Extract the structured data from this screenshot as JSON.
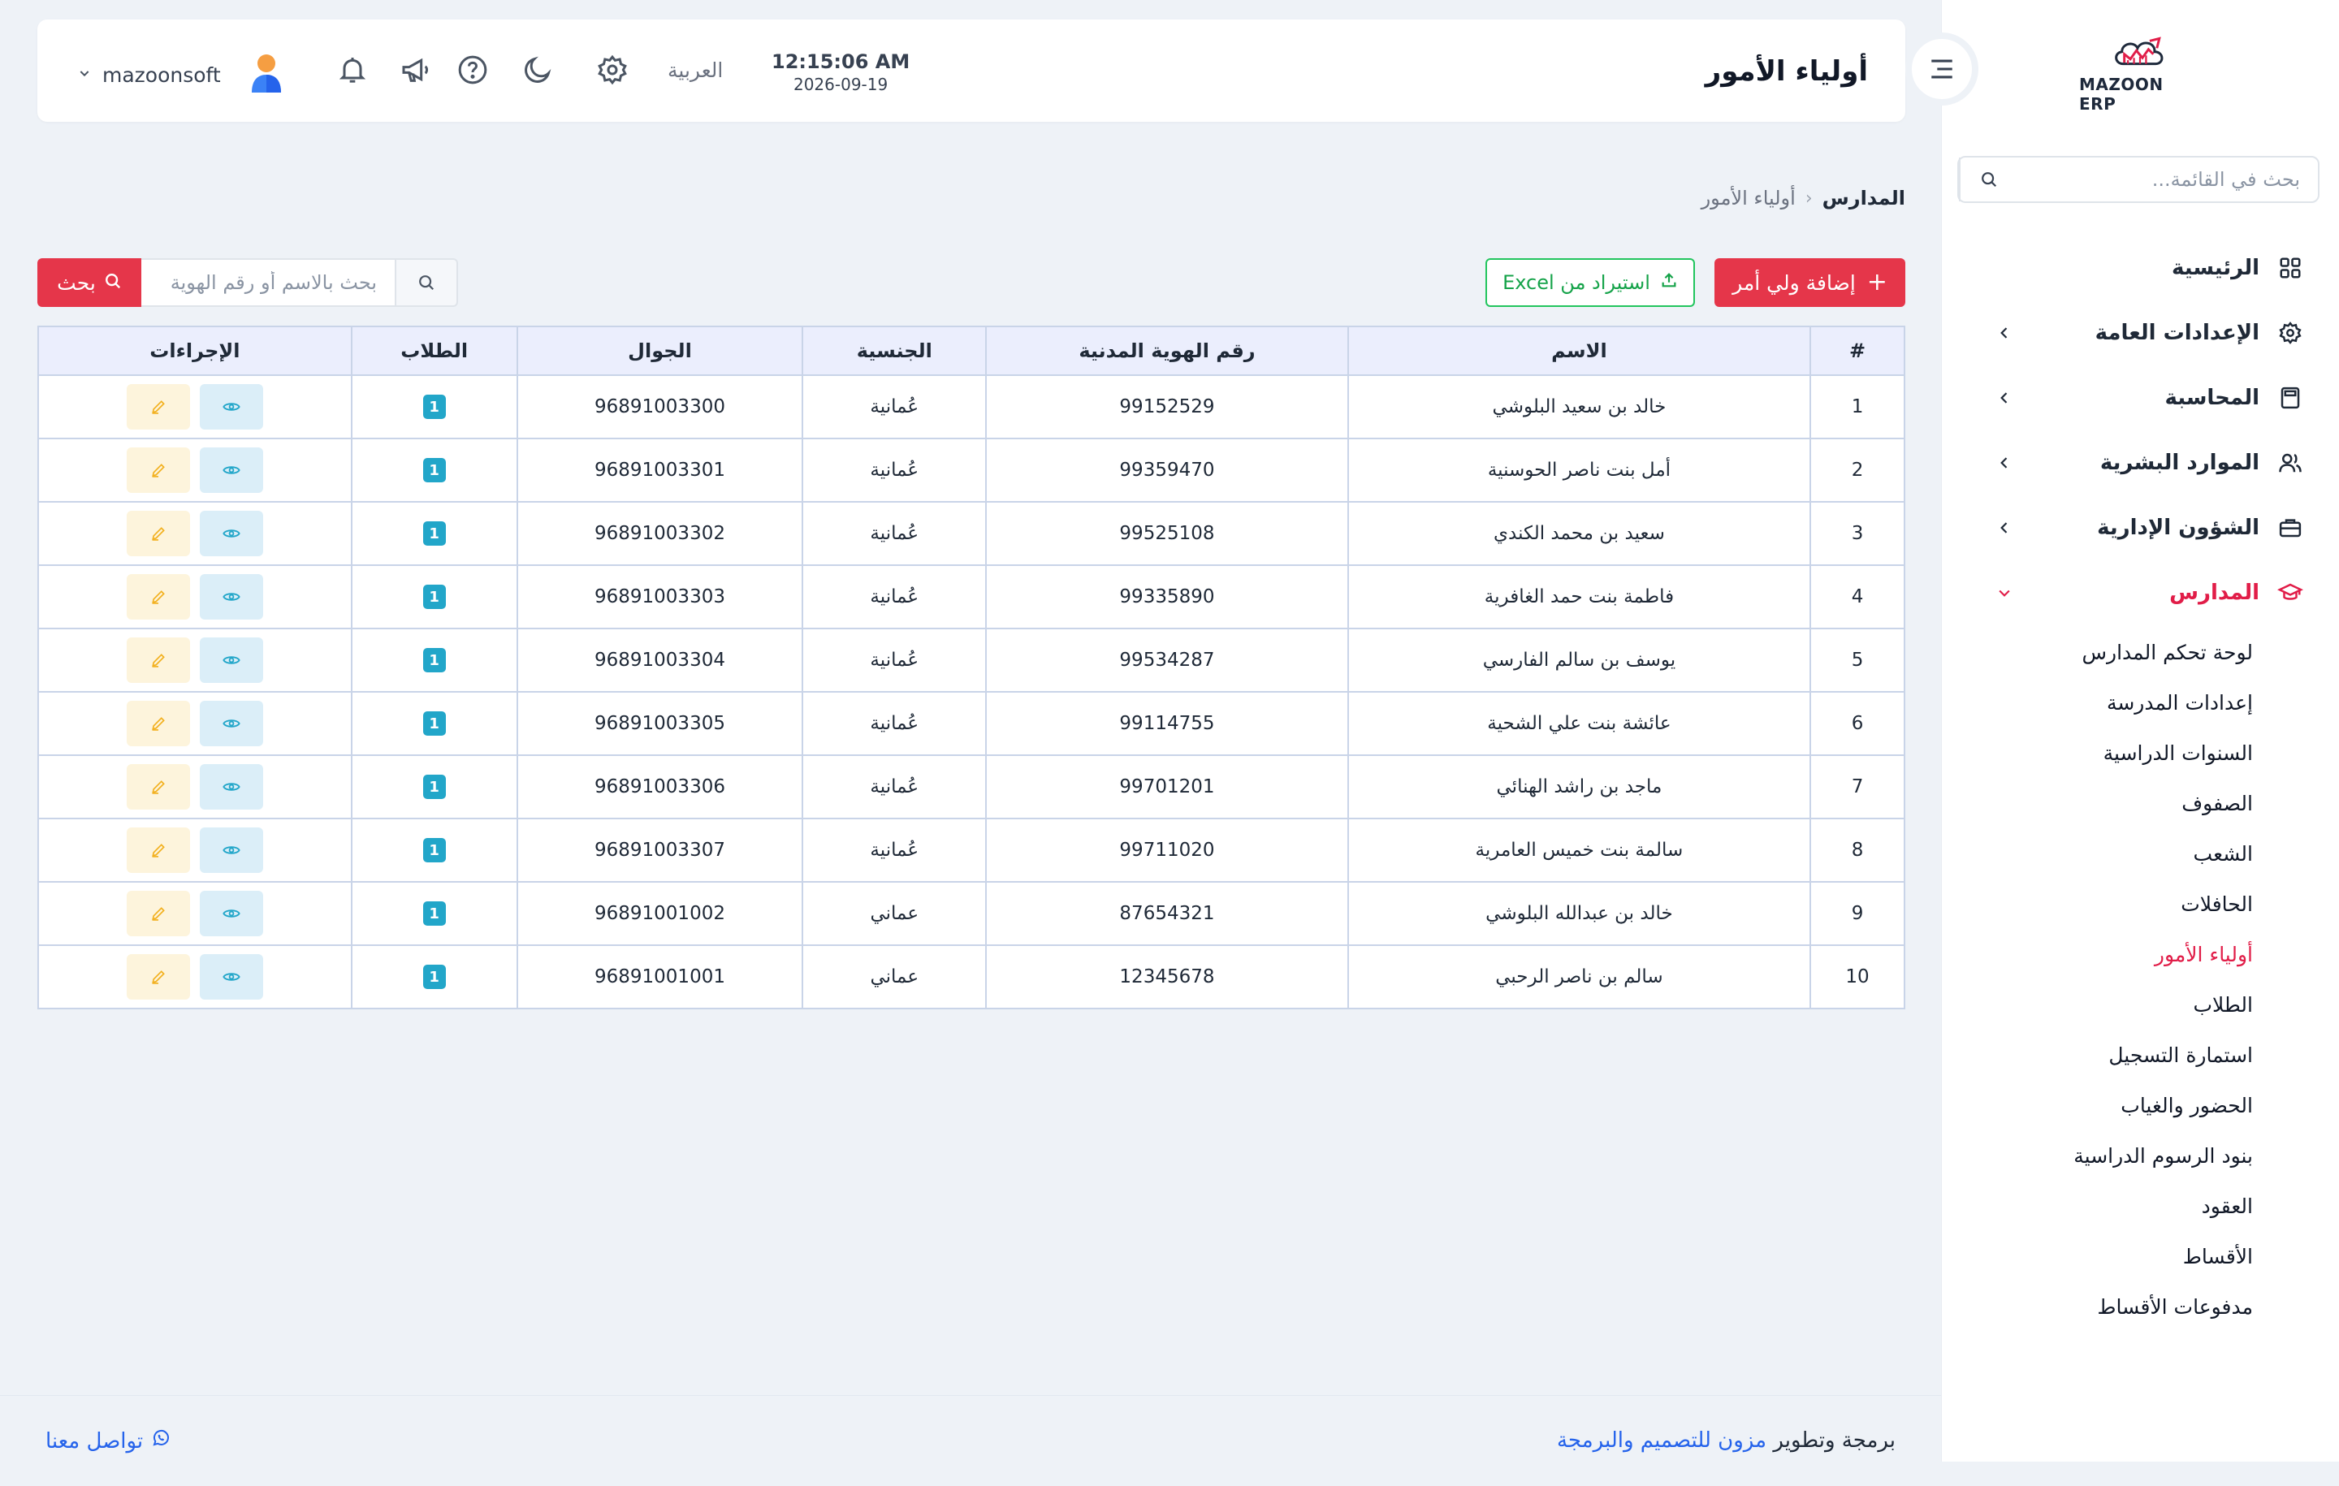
{
  "header": {
    "page_title": "أولياء الأمور",
    "time": "12:15:06 AM",
    "date": "2026-09-19",
    "language": "العربية",
    "username": "mazoonsoft"
  },
  "sidebar": {
    "logo_text": "MAZOON ERP",
    "search_placeholder": "بحث في القائمة...",
    "items": [
      {
        "label": "الرئيسية",
        "icon": "grid-icon",
        "has_children": false
      },
      {
        "label": "الإعدادات العامة",
        "icon": "gear-icon",
        "has_children": true
      },
      {
        "label": "المحاسبة",
        "icon": "calculator-icon",
        "has_children": true
      },
      {
        "label": "الموارد البشرية",
        "icon": "users-icon",
        "has_children": true
      },
      {
        "label": "الشؤون الإدارية",
        "icon": "briefcase-icon",
        "has_children": true
      },
      {
        "label": "المدارس",
        "icon": "graduation-cap-icon",
        "has_children": true,
        "expanded": true
      }
    ],
    "school_submenu": [
      "لوحة تحكم المدارس",
      "إعدادات المدرسة",
      "السنوات الدراسية",
      "الصفوف",
      "الشعب",
      "الحافلات",
      "أولياء الأمور",
      "الطلاب",
      "استمارة التسجيل",
      "الحضور والغياب",
      "بنود الرسوم الدراسية",
      "العقود",
      "الأقساط",
      "مدفوعات الأقساط"
    ],
    "active_submenu": "أولياء الأمور"
  },
  "breadcrumb": {
    "root": "المدارس",
    "separator": "‹",
    "current": "أولياء الأمور"
  },
  "toolbar": {
    "add_label": "إضافة ولي أمر",
    "add_icon": "+",
    "excel_label": "استيراد من Excel",
    "search_placeholder": "بحث بالاسم أو رقم الهوية",
    "search_button": "بحث"
  },
  "table": {
    "columns": [
      "#",
      "الاسم",
      "رقم الهوية المدنية",
      "الجنسية",
      "الجوال",
      "الطلاب",
      "الإجراءات"
    ],
    "rows": [
      {
        "no": "1",
        "name": "خالد بن سعيد البلوشي",
        "civil_id": "99152529",
        "nationality": "عُمانية",
        "mobile": "96891003300",
        "students": "1"
      },
      {
        "no": "2",
        "name": "أمل بنت ناصر الحوسنية",
        "civil_id": "99359470",
        "nationality": "عُمانية",
        "mobile": "96891003301",
        "students": "1"
      },
      {
        "no": "3",
        "name": "سعيد بن محمد الكندي",
        "civil_id": "99525108",
        "nationality": "عُمانية",
        "mobile": "96891003302",
        "students": "1"
      },
      {
        "no": "4",
        "name": "فاطمة بنت حمد الغافرية",
        "civil_id": "99335890",
        "nationality": "عُمانية",
        "mobile": "96891003303",
        "students": "1"
      },
      {
        "no": "5",
        "name": "يوسف بن سالم الفارسي",
        "civil_id": "99534287",
        "nationality": "عُمانية",
        "mobile": "96891003304",
        "students": "1"
      },
      {
        "no": "6",
        "name": "عائشة بنت علي الشحية",
        "civil_id": "99114755",
        "nationality": "عُمانية",
        "mobile": "96891003305",
        "students": "1"
      },
      {
        "no": "7",
        "name": "ماجد بن راشد الهنائي",
        "civil_id": "99701201",
        "nationality": "عُمانية",
        "mobile": "96891003306",
        "students": "1"
      },
      {
        "no": "8",
        "name": "سالمة بنت خميس العامرية",
        "civil_id": "99711020",
        "nationality": "عُمانية",
        "mobile": "96891003307",
        "students": "1"
      },
      {
        "no": "9",
        "name": "خالد بن عبدالله البلوشي",
        "civil_id": "87654321",
        "nationality": "عماني",
        "mobile": "96891001002",
        "students": "1"
      },
      {
        "no": "10",
        "name": "سالم بن ناصر الرحبي",
        "civil_id": "12345678",
        "nationality": "عماني",
        "mobile": "96891001001",
        "students": "1"
      }
    ]
  },
  "footer": {
    "credit_prefix": "برمجة وتطوير",
    "credit_company": "مزون للتصميم والبرمجة",
    "contact_label": "تواصل معنا"
  },
  "colors": {
    "accent": "#e5364a",
    "excel": "#22c55e",
    "badge": "#22a6c9",
    "link": "#2563eb",
    "active_nav": "#e11d48"
  }
}
